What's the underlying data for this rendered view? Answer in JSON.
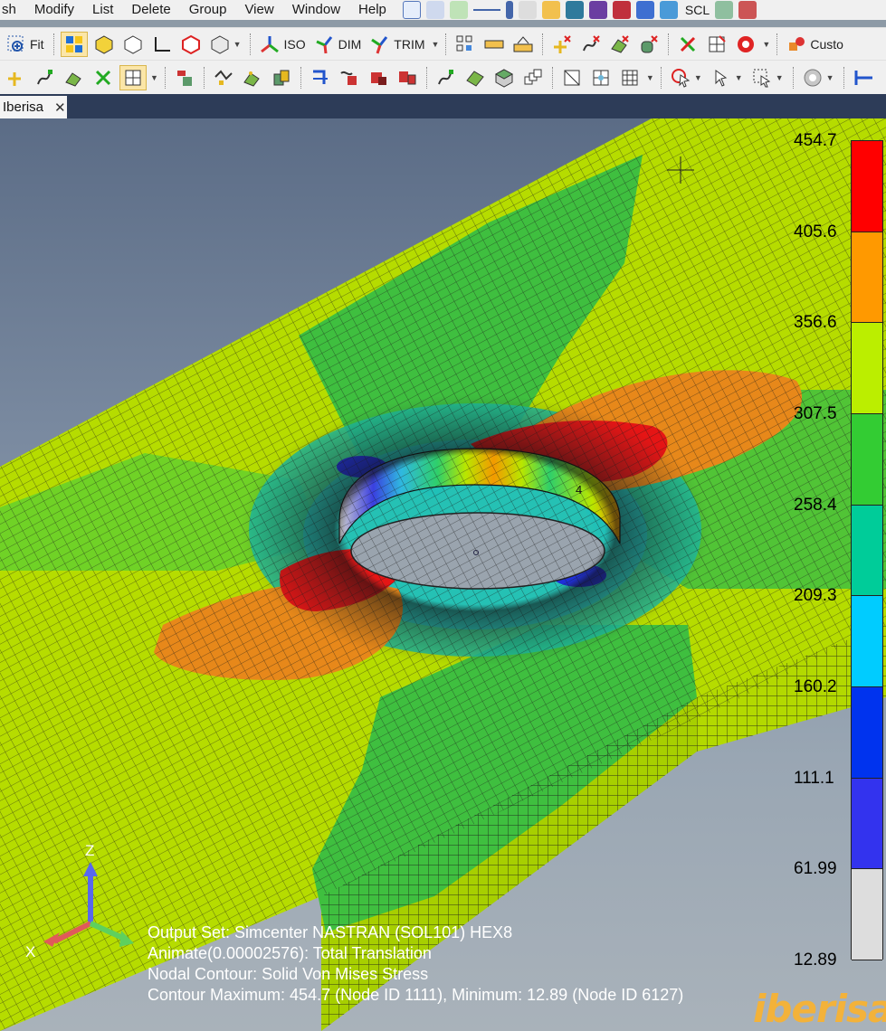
{
  "menu": {
    "items": [
      "sh",
      "Modify",
      "List",
      "Delete",
      "Group",
      "View",
      "Window",
      "Help"
    ],
    "scl_label": "SCL"
  },
  "toolbar2": {
    "fit_label": "Fit",
    "iso_label": "ISO",
    "dim_label": "DIM",
    "trim_label": "TRIM",
    "custom_label": "Custo"
  },
  "tab": {
    "label": "Iberisa",
    "close": "✕"
  },
  "legend": {
    "labels": [
      "454.7",
      "405.6",
      "356.6",
      "307.5",
      "258.4",
      "209.3",
      "160.2",
      "111.1",
      "61.99",
      "12.89"
    ],
    "colors": [
      "#ff0000",
      "#ff9900",
      "#bbee00",
      "#33cc33",
      "#00cc99",
      "#00ccff",
      "#0033ee",
      "#3333ee",
      "#dddddd"
    ]
  },
  "info": {
    "line1": "Output Set: Simcenter NASTRAN (SOL101) HEX8",
    "line2": "Animate(0.00002576): Total Translation",
    "line3": "Nodal Contour: Solid Von Mises Stress",
    "line4": "Contour Maximum: 454.7 (Node ID 1111), Minimum: 12.89 (Node ID 6127)"
  },
  "axes": {
    "z": "Z",
    "x": "X"
  },
  "marker": "4",
  "watermark": "iberisa"
}
